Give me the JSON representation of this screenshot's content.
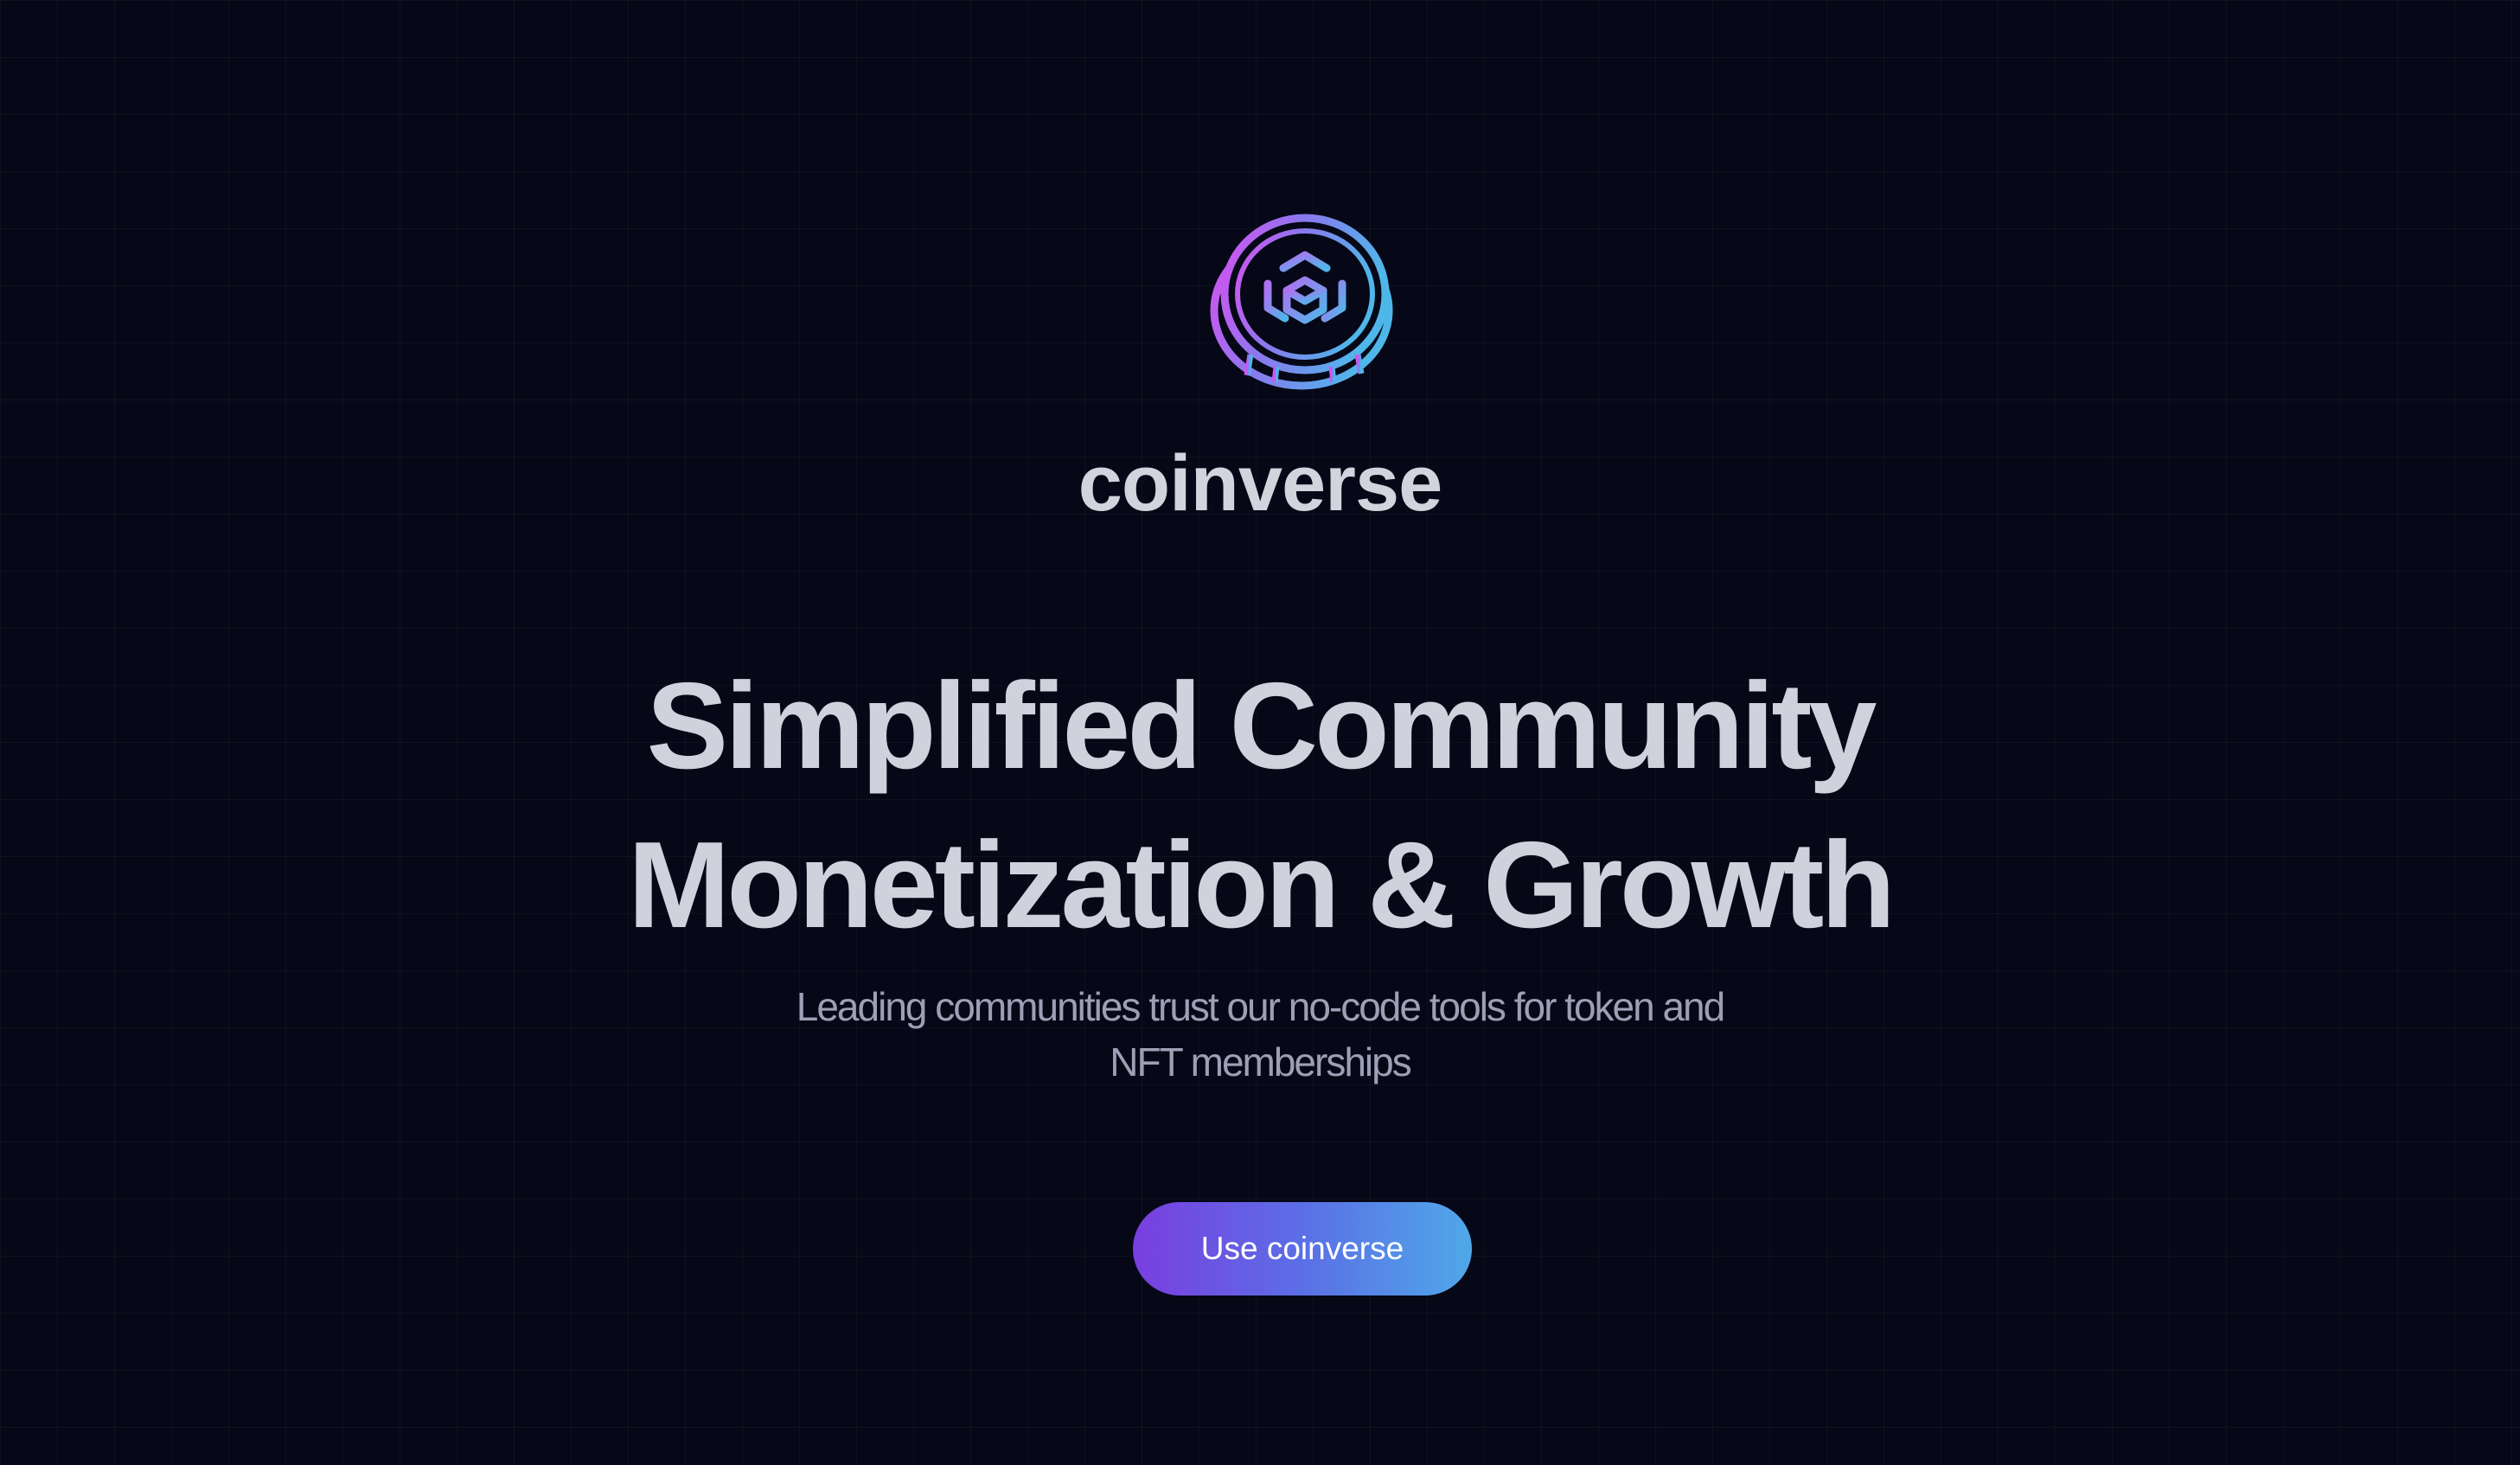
{
  "brand": {
    "logo_icon": "coin-cube-icon",
    "name": "coinverse"
  },
  "hero": {
    "headline_line1": "Simplified Community",
    "headline_line2": "Monetization & Growth",
    "subtitle": "Leading communities trust our no-code tools for token and NFT memberships"
  },
  "cta": {
    "label": "Use coinverse"
  },
  "colors": {
    "background": "#060817",
    "text_primary": "#d0d1dc",
    "text_secondary": "#9d9fb5",
    "gradient_start": "#7a3ee0",
    "gradient_end": "#4fa8e8",
    "logo_pink": "#d552f0",
    "logo_blue": "#4fb6ea"
  }
}
